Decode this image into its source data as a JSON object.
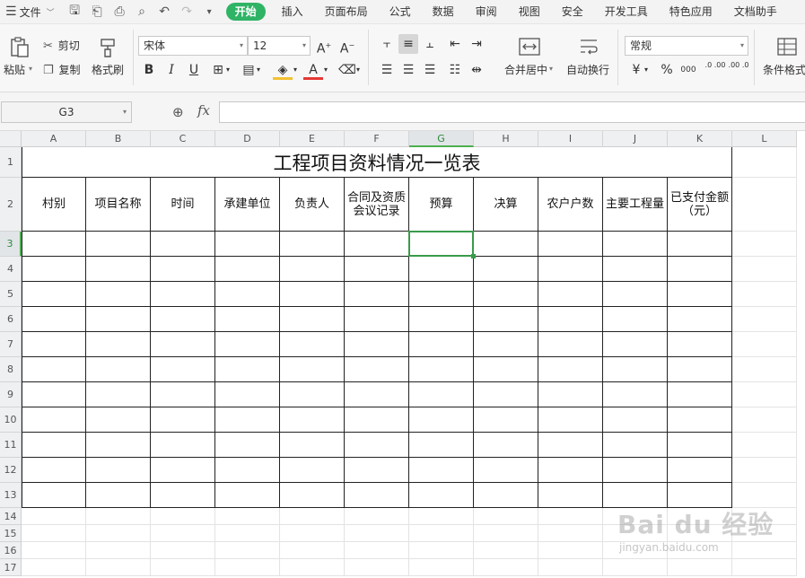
{
  "menubar": {
    "file_label": "文件",
    "tabs": [
      "开始",
      "插入",
      "页面布局",
      "公式",
      "数据",
      "审阅",
      "视图",
      "安全",
      "开发工具",
      "特色应用",
      "文档助手"
    ],
    "active_tab": "开始"
  },
  "ribbon": {
    "paste": "粘贴",
    "cut": "剪切",
    "copy": "复制",
    "format_painter": "格式刷",
    "font_name": "宋体",
    "font_size": "12",
    "merge_center": "合并居中",
    "wrap_text": "自动换行",
    "number_format": "常规",
    "conditional_format": "条件格式",
    "percent_symbol": "%",
    "thousands_symbol": "000",
    "inc_decimal": ".0 .00",
    "dec_decimal": ".00 .0"
  },
  "formula_bar": {
    "name_box": "G3",
    "fx_label": "fx",
    "value": ""
  },
  "grid": {
    "columns": [
      "A",
      "B",
      "C",
      "D",
      "E",
      "F",
      "G",
      "H",
      "I",
      "J",
      "K",
      "L"
    ],
    "rows": [
      "1",
      "2",
      "3",
      "4",
      "5",
      "6",
      "7",
      "8",
      "9",
      "10",
      "11",
      "12",
      "13",
      "14",
      "15",
      "16",
      "17"
    ],
    "selected_cell": "G3",
    "selected_col": "G",
    "selected_row": "3"
  },
  "sheet": {
    "title": "工程项目资料情况一览表",
    "headers": [
      "村别",
      "项目名称",
      "时间",
      "承建单位",
      "负责人",
      "合同及资质\n会议记录",
      "预算",
      "决算",
      "农户户数",
      "主要工程量",
      "已支付金额（元）"
    ]
  },
  "colors": {
    "accent": "#2fb365",
    "selection": "#3a9b4a"
  },
  "watermark": {
    "text": "Bai du 经验",
    "sub": "jingyan.baidu.com"
  }
}
